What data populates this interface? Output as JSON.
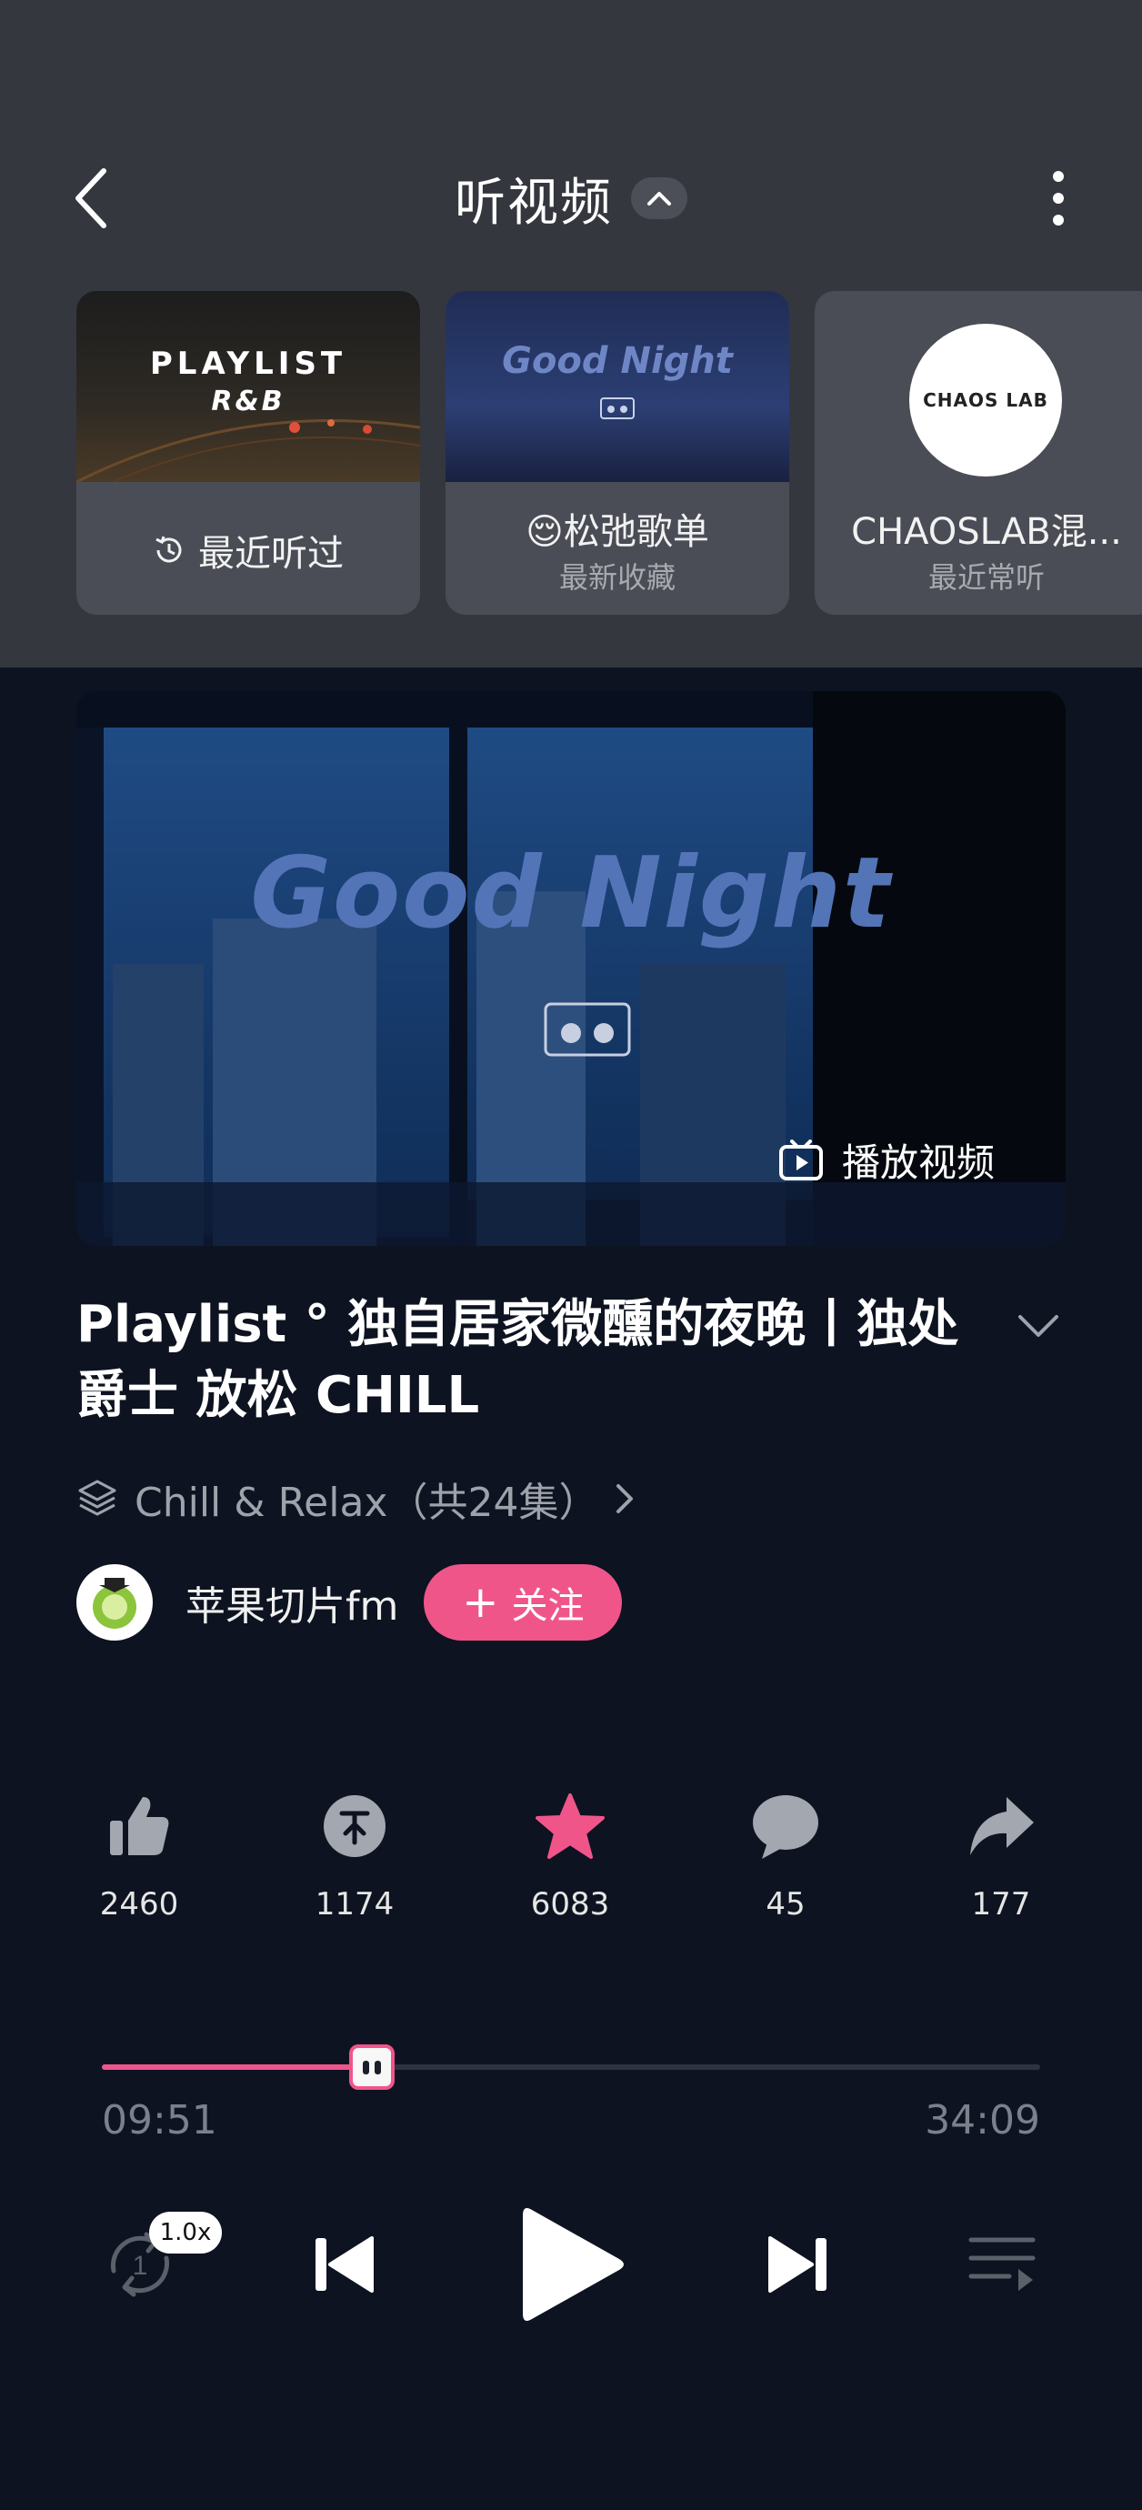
{
  "header": {
    "title": "听视频"
  },
  "recent_cards": [
    {
      "thumb_line1": "PLAYLIST",
      "thumb_line2": "R&B",
      "label": "最近听过"
    },
    {
      "thumb_text": "Good Night",
      "label": "😌松弛歌单",
      "sub": "最新收藏"
    },
    {
      "avatar_text": "CHAOS LAB",
      "label": "CHAOSLAB混...",
      "sub": "最近常听"
    }
  ],
  "video": {
    "overlay_title": "Good Night",
    "play_video_label": "播放视频"
  },
  "episode": {
    "title": "Playlist ° 独自居家微醺的夜晚丨独处 爵士 放松 CHILL",
    "collection": "Chill & Relax（共24集）"
  },
  "author": {
    "name": "苹果切片fm",
    "follow_label": "关注"
  },
  "actions": [
    {
      "name": "like",
      "icon": "thumbs-up-icon",
      "count": "2460"
    },
    {
      "name": "coin",
      "icon": "coin-icon",
      "count": "1174"
    },
    {
      "name": "favorite",
      "icon": "star-icon",
      "count": "6083"
    },
    {
      "name": "comment",
      "icon": "comment-icon",
      "count": "45"
    },
    {
      "name": "share",
      "icon": "share-icon",
      "count": "177"
    }
  ],
  "player": {
    "current_time": "09:51",
    "total_time": "34:09",
    "progress": 0.288,
    "speed": "1.0x",
    "loop_count": "1"
  },
  "colors": {
    "accent": "#f0558a",
    "top_panel": "#34373e",
    "background": "#0d1320"
  }
}
